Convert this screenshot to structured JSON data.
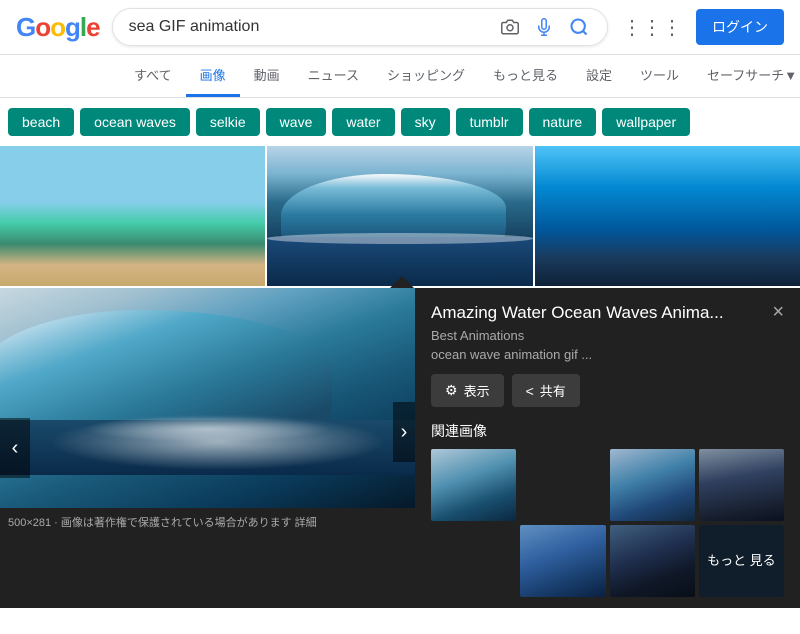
{
  "header": {
    "logo_text": "Google",
    "search_value": "sea GIF animation",
    "search_placeholder": "sea GIF animation",
    "login_label": "ログイン"
  },
  "nav": {
    "tabs": [
      {
        "id": "all",
        "label": "すべて",
        "active": false
      },
      {
        "id": "images",
        "label": "画像",
        "active": true
      },
      {
        "id": "video",
        "label": "動画",
        "active": false
      },
      {
        "id": "news",
        "label": "ニュース",
        "active": false
      },
      {
        "id": "shopping",
        "label": "ショッピング",
        "active": false
      },
      {
        "id": "more",
        "label": "もっと見る",
        "active": false
      },
      {
        "id": "settings",
        "label": "設定",
        "active": false
      },
      {
        "id": "tools",
        "label": "ツール",
        "active": false
      },
      {
        "id": "safe",
        "label": "セーフサーチ▼",
        "active": false
      }
    ]
  },
  "filters": {
    "pills": [
      {
        "id": "beach",
        "label": "beach"
      },
      {
        "id": "ocean-waves",
        "label": "ocean waves"
      },
      {
        "id": "selkie",
        "label": "selkie"
      },
      {
        "id": "wave",
        "label": "wave"
      },
      {
        "id": "water",
        "label": "water"
      },
      {
        "id": "sky",
        "label": "sky"
      },
      {
        "id": "tumblr",
        "label": "tumblr"
      },
      {
        "id": "nature",
        "label": "nature"
      },
      {
        "id": "wallpaper",
        "label": "wallpaper"
      }
    ]
  },
  "detail_panel": {
    "title": "Amazing Water Ocean Waves Anima...",
    "source": "Best Animations",
    "description": "ocean wave animation gif ...",
    "view_label": "表示",
    "share_label": "共有",
    "related_label": "関連画像",
    "more_label": "もっと\n見る",
    "close_label": "×",
    "caption": "500×281 · 画像は著作権で保護されている場合があります 詳細"
  }
}
